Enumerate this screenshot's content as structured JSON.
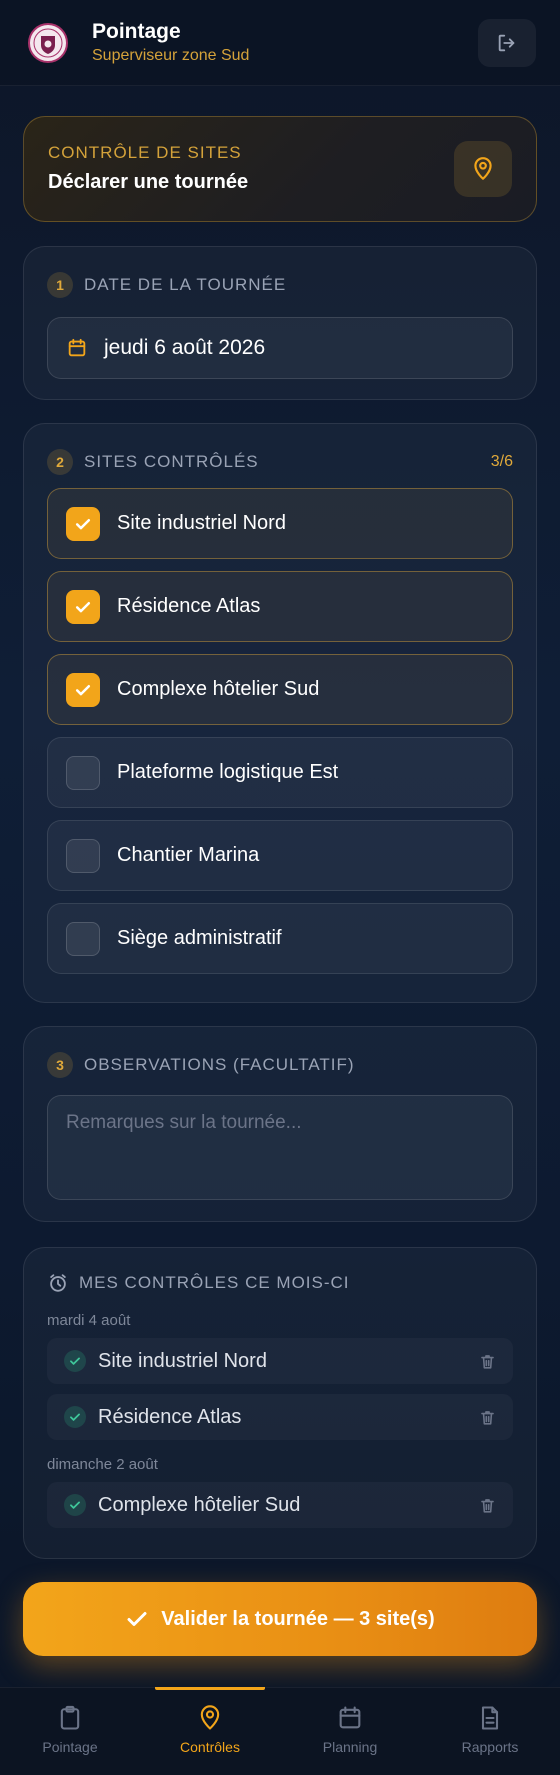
{
  "header": {
    "title": "Pointage",
    "subtitle": "Superviseur zone Sud",
    "logo_icon": "shield-logo",
    "logout_icon": "logout-icon"
  },
  "hero": {
    "kicker": "CONTRÔLE DE SITES",
    "title": "Déclarer une tournée",
    "icon": "map-pin-icon"
  },
  "date_section": {
    "step": "1",
    "label": "DATE DE LA TOURNÉE",
    "value": "jeudi 6 août 2026"
  },
  "sites_section": {
    "step": "2",
    "label": "SITES CONTRÔLÉS",
    "count": "3/6",
    "items": [
      {
        "name": "Site industriel Nord",
        "checked": true
      },
      {
        "name": "Résidence Atlas",
        "checked": true
      },
      {
        "name": "Complexe hôtelier Sud",
        "checked": true
      },
      {
        "name": "Plateforme logistique Est",
        "checked": false
      },
      {
        "name": "Chantier Marina",
        "checked": false
      },
      {
        "name": "Siège administratif",
        "checked": false
      }
    ]
  },
  "observations": {
    "step": "3",
    "label": "OBSERVATIONS (FACULTATIF)",
    "placeholder": "Remarques sur la tournée...",
    "value": ""
  },
  "month_controls": {
    "label": "MES CONTRÔLES CE MOIS-CI",
    "groups": [
      {
        "day": "mardi 4 août",
        "items": [
          "Site industriel Nord",
          "Résidence Atlas"
        ]
      },
      {
        "day": "dimanche 2 août",
        "items": [
          "Complexe hôtelier Sud"
        ]
      }
    ]
  },
  "validate_button": "Valider la tournée — 3 site(s)",
  "nav": [
    {
      "label": "Pointage",
      "icon": "clipboard-icon",
      "active": false
    },
    {
      "label": "Contrôles",
      "icon": "map-pin-icon",
      "active": true
    },
    {
      "label": "Planning",
      "icon": "calendar-icon",
      "active": false
    },
    {
      "label": "Rapports",
      "icon": "document-icon",
      "active": false
    }
  ],
  "colors": {
    "accent": "#f2a51a",
    "background": "#0f1e36",
    "success": "#28a078"
  }
}
